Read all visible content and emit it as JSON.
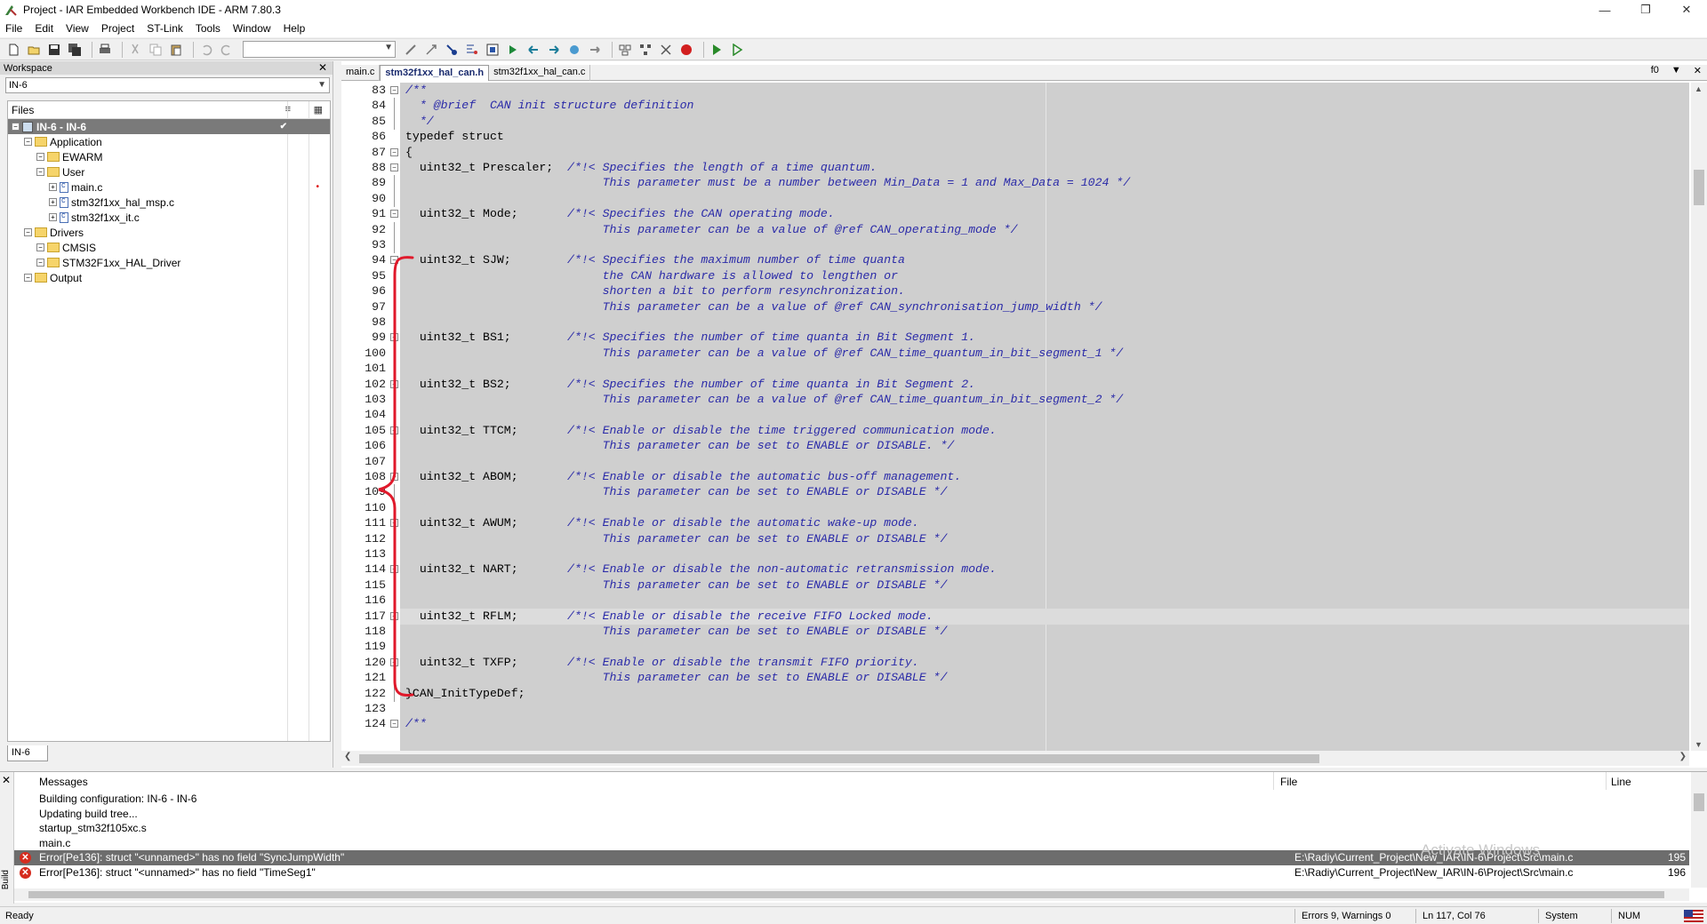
{
  "window": {
    "title": "Project - IAR Embedded Workbench IDE - ARM 7.80.3",
    "min": "—",
    "max": "❐",
    "close": "✕"
  },
  "menu": [
    "File",
    "Edit",
    "View",
    "Project",
    "ST-Link",
    "Tools",
    "Window",
    "Help"
  ],
  "workspace": {
    "header": "Workspace",
    "config": "IN-6",
    "files_label": "Files",
    "tab": "IN-6",
    "tree": [
      {
        "label": "IN-6 - IN-6",
        "level": 0,
        "type": "project",
        "selected": true
      },
      {
        "label": "Application",
        "level": 1,
        "type": "folder"
      },
      {
        "label": "EWARM",
        "level": 2,
        "type": "folder"
      },
      {
        "label": "User",
        "level": 2,
        "type": "folder"
      },
      {
        "label": "main.c",
        "level": 3,
        "type": "file",
        "dot": true
      },
      {
        "label": "stm32f1xx_hal_msp.c",
        "level": 3,
        "type": "file"
      },
      {
        "label": "stm32f1xx_it.c",
        "level": 3,
        "type": "file"
      },
      {
        "label": "Drivers",
        "level": 1,
        "type": "folder"
      },
      {
        "label": "CMSIS",
        "level": 2,
        "type": "folder"
      },
      {
        "label": "STM32F1xx_HAL_Driver",
        "level": 2,
        "type": "folder"
      },
      {
        "label": "Output",
        "level": 1,
        "type": "folder"
      }
    ]
  },
  "editor": {
    "tabs": [
      {
        "label": "main.c",
        "active": false
      },
      {
        "label": "stm32f1xx_hal_can.h",
        "active": true
      },
      {
        "label": "stm32f1xx_hal_can.c",
        "active": false
      }
    ],
    "func_box": "f0",
    "lines": [
      {
        "n": "83",
        "code": "/**",
        "comment": true,
        "fold": "box"
      },
      {
        "n": "84",
        "code": "  * @brief  CAN init structure definition",
        "comment": true,
        "fold": "line"
      },
      {
        "n": "85",
        "code": "  */",
        "comment": true,
        "fold": "line"
      },
      {
        "n": "86",
        "code": "typedef struct",
        "comment": false,
        "fold": ""
      },
      {
        "n": "87",
        "code": "{",
        "comment": false,
        "fold": "box"
      },
      {
        "n": "88",
        "code": "  uint32_t Prescaler;  ",
        "tail": "/*!< Specifies the length of a time quantum.",
        "fold": "box"
      },
      {
        "n": "89",
        "code": "                       ",
        "tail": "     This parameter must be a number between Min_Data = 1 and Max_Data = 1024 */",
        "fold": "line"
      },
      {
        "n": "90",
        "code": "",
        "fold": "line"
      },
      {
        "n": "91",
        "code": "  uint32_t Mode;       ",
        "tail": "/*!< Specifies the CAN operating mode.",
        "fold": "box"
      },
      {
        "n": "92",
        "code": "                       ",
        "tail": "     This parameter can be a value of @ref CAN_operating_mode */",
        "fold": "line"
      },
      {
        "n": "93",
        "code": "",
        "fold": "line"
      },
      {
        "n": "94",
        "code": "  uint32_t SJW;        ",
        "tail": "/*!< Specifies the maximum number of time quanta",
        "fold": "box"
      },
      {
        "n": "95",
        "code": "                       ",
        "tail": "     the CAN hardware is allowed to lengthen or",
        "fold": "line"
      },
      {
        "n": "96",
        "code": "                       ",
        "tail": "     shorten a bit to perform resynchronization.",
        "fold": "line"
      },
      {
        "n": "97",
        "code": "                       ",
        "tail": "     This parameter can be a value of @ref CAN_synchronisation_jump_width */",
        "fold": "line"
      },
      {
        "n": "98",
        "code": "",
        "fold": "line"
      },
      {
        "n": "99",
        "code": "  uint32_t BS1;        ",
        "tail": "/*!< Specifies the number of time quanta in Bit Segment 1.",
        "fold": "box"
      },
      {
        "n": "100",
        "code": "                       ",
        "tail": "     This parameter can be a value of @ref CAN_time_quantum_in_bit_segment_1 */",
        "fold": "line"
      },
      {
        "n": "101",
        "code": "",
        "fold": "line"
      },
      {
        "n": "102",
        "code": "  uint32_t BS2;        ",
        "tail": "/*!< Specifies the number of time quanta in Bit Segment 2.",
        "fold": "box"
      },
      {
        "n": "103",
        "code": "                       ",
        "tail": "     This parameter can be a value of @ref CAN_time_quantum_in_bit_segment_2 */",
        "fold": "line"
      },
      {
        "n": "104",
        "code": "",
        "fold": "line"
      },
      {
        "n": "105",
        "code": "  uint32_t TTCM;       ",
        "tail": "/*!< Enable or disable the time triggered communication mode.",
        "fold": "box"
      },
      {
        "n": "106",
        "code": "                       ",
        "tail": "     This parameter can be set to ENABLE or DISABLE. */",
        "fold": "line"
      },
      {
        "n": "107",
        "code": "",
        "fold": "line"
      },
      {
        "n": "108",
        "code": "  uint32_t ABOM;       ",
        "tail": "/*!< Enable or disable the automatic bus-off management.",
        "fold": "box"
      },
      {
        "n": "109",
        "code": "                       ",
        "tail": "     This parameter can be set to ENABLE or DISABLE */",
        "fold": "line"
      },
      {
        "n": "110",
        "code": "",
        "fold": "line"
      },
      {
        "n": "111",
        "code": "  uint32_t AWUM;       ",
        "tail": "/*!< Enable or disable the automatic wake-up mode.",
        "fold": "box"
      },
      {
        "n": "112",
        "code": "                       ",
        "tail": "     This parameter can be set to ENABLE or DISABLE */",
        "fold": "line"
      },
      {
        "n": "113",
        "code": "",
        "fold": "line"
      },
      {
        "n": "114",
        "code": "  uint32_t NART;       ",
        "tail": "/*!< Enable or disable the non-automatic retransmission mode.",
        "fold": "box"
      },
      {
        "n": "115",
        "code": "                       ",
        "tail": "     This parameter can be set to ENABLE or DISABLE */",
        "fold": "line"
      },
      {
        "n": "116",
        "code": "",
        "fold": "line"
      },
      {
        "n": "117",
        "code": "  uint32_t RFLM;       ",
        "tail": "/*!< Enable or disable the receive FIFO Locked mode.",
        "fold": "box",
        "current": true
      },
      {
        "n": "118",
        "code": "                       ",
        "tail": "     This parameter can be set to ENABLE or DISABLE */",
        "fold": "line"
      },
      {
        "n": "119",
        "code": "",
        "fold": "line"
      },
      {
        "n": "120",
        "code": "  uint32_t TXFP;       ",
        "tail": "/*!< Enable or disable the transmit FIFO priority.",
        "fold": "box"
      },
      {
        "n": "121",
        "code": "                       ",
        "tail": "     This parameter can be set to ENABLE or DISABLE */",
        "fold": "line"
      },
      {
        "n": "122",
        "code": "}CAN_InitTypeDef;",
        "fold": "line"
      },
      {
        "n": "123",
        "code": "",
        "fold": ""
      },
      {
        "n": "124",
        "code": "/**",
        "comment": true,
        "fold": "box"
      }
    ]
  },
  "messages": {
    "col_messages": "Messages",
    "col_file": "File",
    "col_line": "Line",
    "build_tab": "Build",
    "rows": [
      {
        "text": "Building configuration: IN-6 - IN-6",
        "type": "info",
        "file": "",
        "line": ""
      },
      {
        "text": "Updating build tree...",
        "type": "info",
        "file": "",
        "line": ""
      },
      {
        "text": "startup_stm32f105xc.s",
        "type": "info",
        "file": "",
        "line": ""
      },
      {
        "text": "main.c",
        "type": "info",
        "file": "",
        "line": ""
      },
      {
        "text": "Error[Pe136]: struct \"<unnamed>\" has no field \"SyncJumpWidth\"",
        "type": "error-selected",
        "file": "E:\\Radiy\\Current_Project\\New_IAR\\IN-6\\Project\\Src\\main.c",
        "line": "195"
      },
      {
        "text": "Error[Pe136]: struct \"<unnamed>\" has no field \"TimeSeg1\"",
        "type": "error",
        "file": "E:\\Radiy\\Current_Project\\New_IAR\\IN-6\\Project\\Src\\main.c",
        "line": "196"
      }
    ],
    "watermark": "Activate Windows"
  },
  "status": {
    "ready": "Ready",
    "errors": "Errors 9, Warnings 0",
    "position": "Ln 117, Col 76",
    "system": "System",
    "num": "NUM"
  }
}
